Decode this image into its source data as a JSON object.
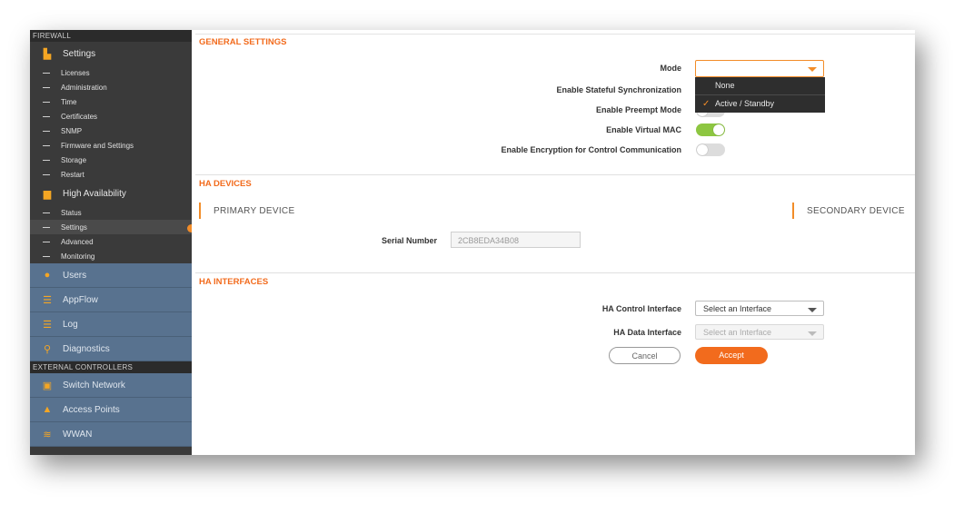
{
  "sidebar": {
    "firewall_header": "FIREWALL",
    "settings": {
      "label": "Settings",
      "icon": "settings-icon"
    },
    "settings_items": [
      {
        "label": "Licenses"
      },
      {
        "label": "Administration"
      },
      {
        "label": "Time"
      },
      {
        "label": "Certificates"
      },
      {
        "label": "SNMP"
      },
      {
        "label": "Firmware and Settings"
      },
      {
        "label": "Storage"
      },
      {
        "label": "Restart"
      }
    ],
    "high_availability": {
      "label": "High Availability",
      "icon": "gift-icon"
    },
    "ha_items": [
      {
        "label": "Status"
      },
      {
        "label": "Settings",
        "active": true
      },
      {
        "label": "Advanced"
      },
      {
        "label": "Monitoring"
      }
    ],
    "blue_items": [
      {
        "label": "Users",
        "icon": "user-icon"
      },
      {
        "label": "AppFlow",
        "icon": "appflow-icon"
      },
      {
        "label": "Log",
        "icon": "log-icon"
      },
      {
        "label": "Diagnostics",
        "icon": "diagnostics-icon"
      }
    ],
    "external_header": "EXTERNAL CONTROLLERS",
    "external_items": [
      {
        "label": "Switch Network",
        "icon": "switch-icon"
      },
      {
        "label": "Access Points",
        "icon": "access-point-icon"
      },
      {
        "label": "WWAN",
        "icon": "wifi-icon"
      }
    ]
  },
  "general": {
    "title": "GENERAL SETTINGS",
    "mode_label": "Mode",
    "mode_value": "",
    "mode_options": [
      "None",
      "Active / Standby"
    ],
    "mode_selected": "Active / Standby",
    "stateful_label": "Enable Stateful Synchronization",
    "preempt_label": "Enable Preempt Mode",
    "virtual_mac_label": "Enable Virtual MAC",
    "virtual_mac_on": true,
    "encryption_label": "Enable Encryption for Control Communication",
    "encryption_on": false
  },
  "devices": {
    "title": "HA DEVICES",
    "primary": "PRIMARY DEVICE",
    "secondary": "SECONDARY DEVICE",
    "serial_label": "Serial Number",
    "serial_value": "2CB8EDA34B08"
  },
  "interfaces": {
    "title": "HA INTERFACES",
    "control_label": "HA Control Interface",
    "control_value": "Select an Interface",
    "data_label": "HA Data Interface",
    "data_value": "Select an Interface",
    "cancel": "Cancel",
    "accept": "Accept"
  },
  "colors": {
    "accent": "#f26b1d",
    "toggle_on": "#8dc641",
    "sidebar": "#3a3a3a",
    "sidebar_blue": "#58728f"
  }
}
